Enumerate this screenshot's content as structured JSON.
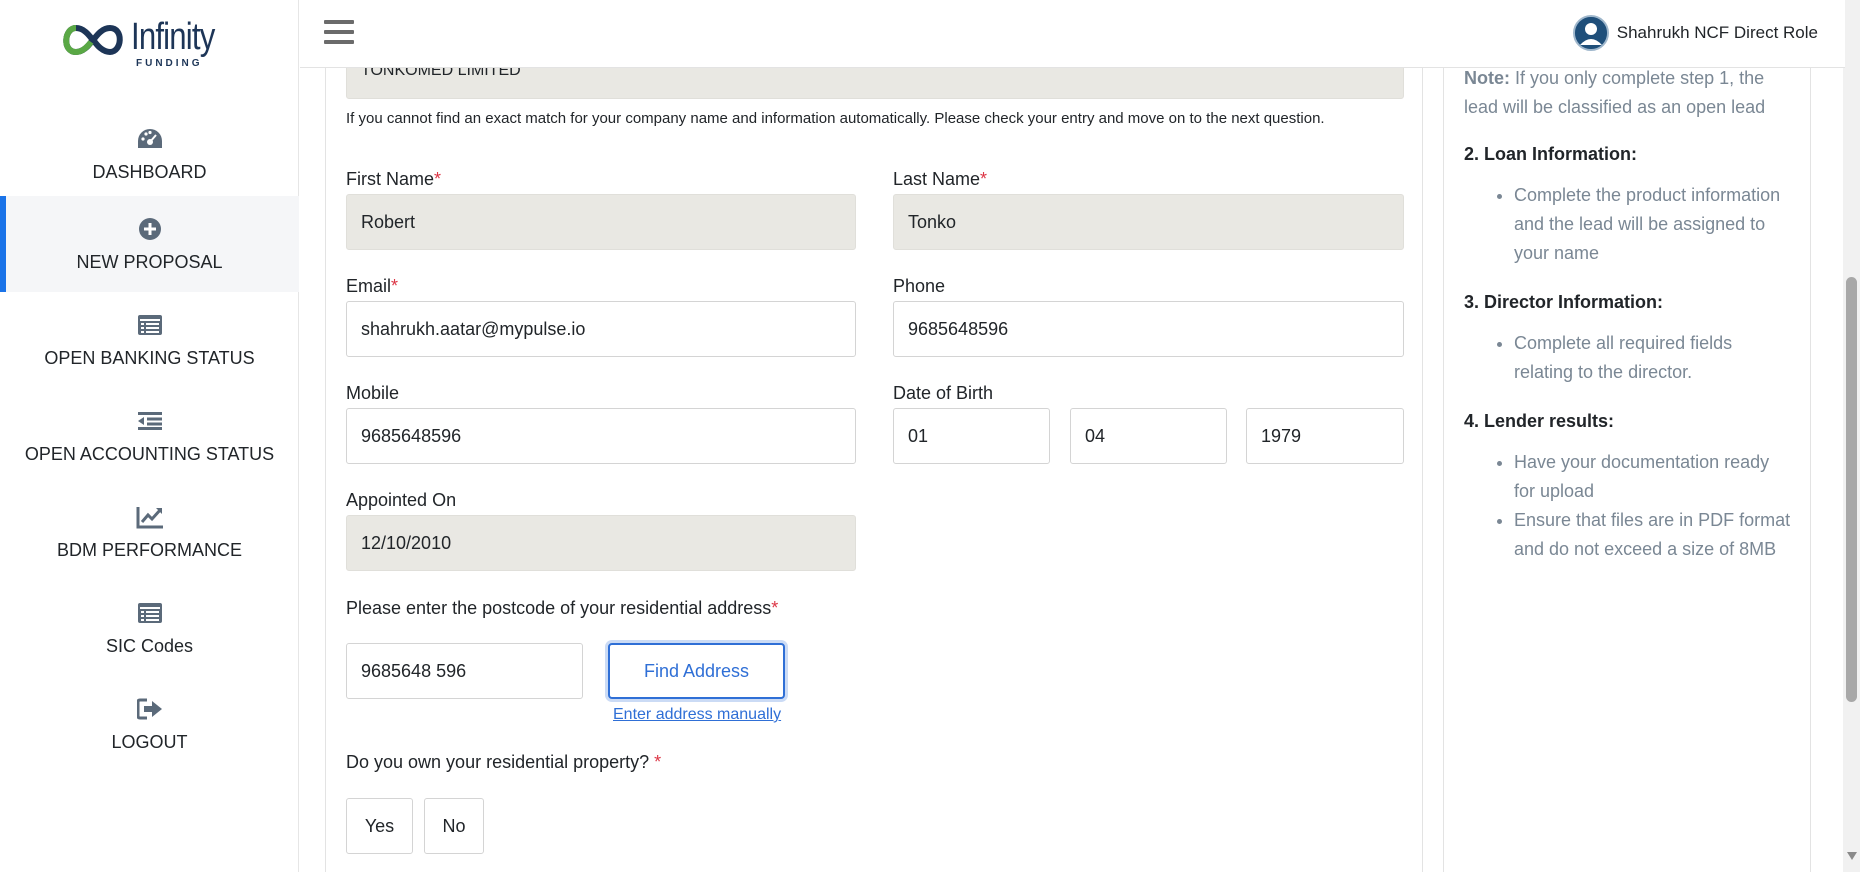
{
  "brand": {
    "name": "Infinity",
    "sub": "FUNDING"
  },
  "nav": [
    {
      "label": "DASHBOARD",
      "icon": "dashboard-icon"
    },
    {
      "label": "NEW PROPOSAL",
      "icon": "plus-circle-icon",
      "active": true
    },
    {
      "label": "OPEN BANKING STATUS",
      "icon": "list-icon"
    },
    {
      "label": "OPEN ACCOUNTING STATUS",
      "icon": "outdent-icon"
    },
    {
      "label": "BDM PERFORMANCE",
      "icon": "chart-line-icon"
    },
    {
      "label": "SIC Codes",
      "icon": "list-icon"
    },
    {
      "label": "LOGOUT",
      "icon": "logout-icon"
    }
  ],
  "header": {
    "user_name": "Shahrukh NCF Direct Role"
  },
  "form": {
    "company_value": "TONKOMED LIMITED",
    "company_note": "If you cannot find an exact match for your company name and information automatically. Please check your entry and move on to the next question.",
    "first_name": {
      "label": "First Name",
      "value": "Robert"
    },
    "last_name": {
      "label": "Last Name",
      "value": "Tonko"
    },
    "email": {
      "label": "Email",
      "value": "shahrukh.aatar@mypulse.io"
    },
    "phone": {
      "label": "Phone",
      "value": "9685648596"
    },
    "mobile": {
      "label": "Mobile",
      "value": "9685648596"
    },
    "dob": {
      "label": "Date of Birth",
      "day": "01",
      "month": "04",
      "year": "1979"
    },
    "appointed": {
      "label": "Appointed On",
      "value": "12/10/2010"
    },
    "postcode": {
      "label": "Please enter the postcode of your residential address",
      "value": "9685648 596",
      "find_label": "Find Address",
      "manual_label": "Enter address manually"
    },
    "own_property": {
      "label": "Do you own your residential property? ",
      "yes": "Yes",
      "no": "No"
    }
  },
  "panel": {
    "note_label": "Note:",
    "note_text": " If you only complete step 1, the lead will be classified as an open lead",
    "step2_title": "2. Loan Information:",
    "step2_items": [
      "Complete the product information and the lead will be assigned to your name"
    ],
    "step3_title": "3. Director Information:",
    "step3_items": [
      "Complete all required fields relating to the director."
    ],
    "step4_title": "4. Lender results:",
    "step4_items": [
      "Have your documentation ready for upload",
      "Ensure that files are in PDF format and do not exceed a size of 8MB"
    ]
  },
  "colors": {
    "accent": "#1a73e8",
    "brand": "#1d3557",
    "required": "#dc3545",
    "readonly_bg": "#e9e8e3"
  }
}
